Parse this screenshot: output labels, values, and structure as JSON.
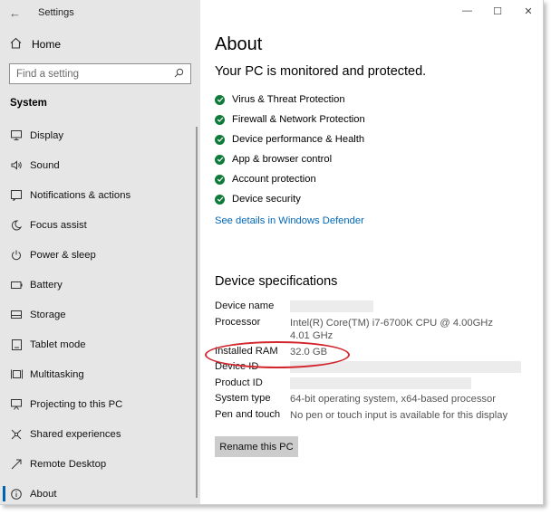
{
  "window": {
    "title": "Settings",
    "controls": [
      "—",
      "☐",
      "✕"
    ]
  },
  "sidebar": {
    "home_label": "Home",
    "search_placeholder": "Find a setting",
    "section_title": "System",
    "items": [
      {
        "label": "Display",
        "icon": "display-icon"
      },
      {
        "label": "Sound",
        "icon": "sound-icon"
      },
      {
        "label": "Notifications & actions",
        "icon": "notifications-icon"
      },
      {
        "label": "Focus assist",
        "icon": "moon-icon"
      },
      {
        "label": "Power & sleep",
        "icon": "power-icon"
      },
      {
        "label": "Battery",
        "icon": "battery-icon"
      },
      {
        "label": "Storage",
        "icon": "storage-icon"
      },
      {
        "label": "Tablet mode",
        "icon": "tablet-icon"
      },
      {
        "label": "Multitasking",
        "icon": "multitasking-icon"
      },
      {
        "label": "Projecting to this PC",
        "icon": "projecting-icon"
      },
      {
        "label": "Shared experiences",
        "icon": "shared-icon"
      },
      {
        "label": "Remote Desktop",
        "icon": "remote-desktop-icon"
      },
      {
        "label": "About",
        "icon": "info-icon"
      }
    ],
    "active_item": "About"
  },
  "main": {
    "title": "About",
    "protection_heading": "Your PC is monitored and protected.",
    "protection_items": [
      "Virus & Threat Protection",
      "Firewall & Network Protection",
      "Device performance & Health",
      "App & browser control",
      "Account protection",
      "Device security"
    ],
    "defender_link": "See details in Windows Defender",
    "specs_heading": "Device specifications",
    "specs": {
      "device_name_label": "Device name",
      "device_name_value": "",
      "processor_label": "Processor",
      "processor_value": "Intel(R) Core(TM) i7-6700K CPU @ 4.00GHz   4.01 GHz",
      "ram_label": "Installed RAM",
      "ram_value": "32.0 GB",
      "device_id_label": "Device ID",
      "device_id_value": "",
      "product_id_label": "Product ID",
      "product_id_value": "",
      "system_type_label": "System type",
      "system_type_value": "64-bit operating system, x64-based processor",
      "pen_touch_label": "Pen and touch",
      "pen_touch_value": "No pen or touch input is available for this display"
    },
    "rename_button": "Rename this PC"
  },
  "colors": {
    "sidebar_bg": "#e6e6e6",
    "accent": "#0063b1",
    "link": "#0066b4",
    "check_green": "#0f7b3a",
    "annotation_red": "#d2262c"
  }
}
